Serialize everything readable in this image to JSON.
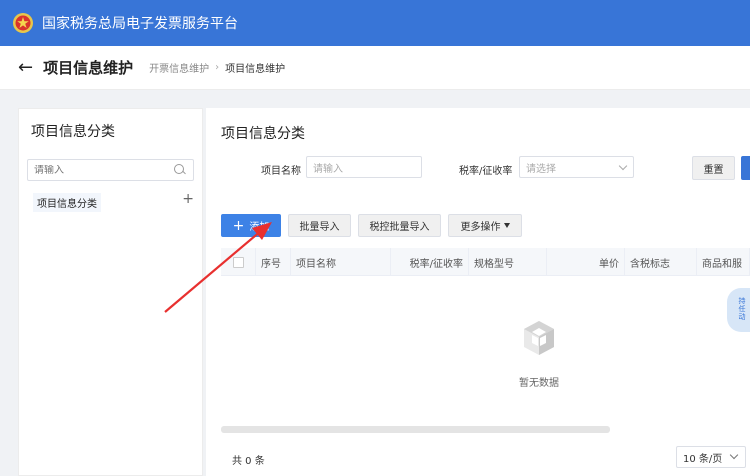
{
  "header": {
    "title": "国家税务总局电子发票服务平台"
  },
  "titlebar": {
    "back_icon": "←",
    "title": "项目信息维护",
    "breadcrumb": [
      "开票信息维护",
      "项目信息维护"
    ],
    "separator": "›"
  },
  "left": {
    "title": "项目信息分类",
    "search_placeholder": "请输入",
    "tree_item": "项目信息分类",
    "add_icon": "+"
  },
  "main": {
    "title": "项目信息分类",
    "filters": {
      "name_label": "项目名称",
      "name_placeholder": "请输入",
      "rate_label": "税率/征收率",
      "rate_placeholder": "请选择"
    },
    "reset_label": "重置",
    "toolbar": {
      "add_label": "添加",
      "batch_import": "批量导入",
      "tax_batch_import": "税控批量导入",
      "more_ops": "更多操作"
    },
    "columns": [
      "序号",
      "项目名称",
      "税率/征收率",
      "规格型号",
      "单价",
      "含税标志",
      "商品和服"
    ],
    "empty_text": "暂无数据",
    "total": "共 0 条",
    "page_size": "10 条/页"
  },
  "float_widget": [
    "持",
    "任",
    "动"
  ],
  "annotation_color": "#e8302f",
  "brand_color": "#3875d7"
}
